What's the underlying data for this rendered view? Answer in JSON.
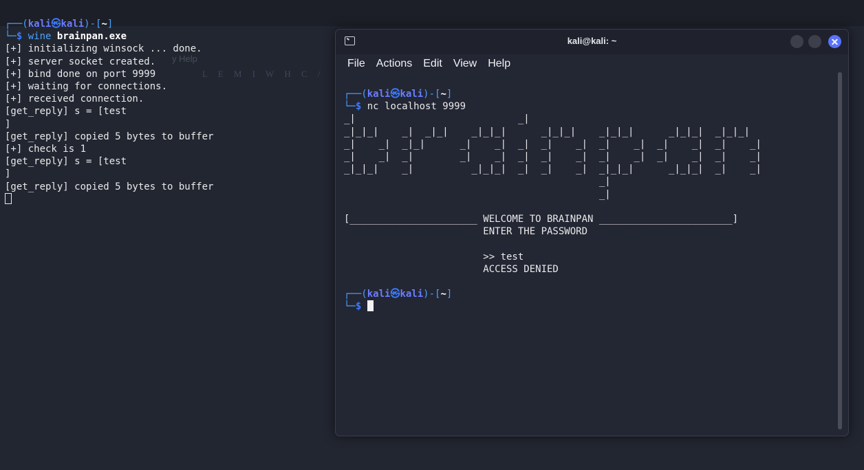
{
  "background": {
    "ghost_menu": "y  Help",
    "ghost_tools": "L E M I W H C /"
  },
  "left_terminal": {
    "prompt_open": "┌──(",
    "user": "kali",
    "at": "㉿",
    "host": "kali",
    "prompt_mid": ")-[",
    "dir": "~",
    "prompt_close": "]",
    "prompt_start": "└─",
    "dollar": "$",
    "cmd": "wine",
    "cmd_arg": "brainpan.exe",
    "lines": [
      "[+] initializing winsock ... done.",
      "[+] server socket created.",
      "[+] bind done on port 9999",
      "[+] waiting for connections.",
      "[+] received connection.",
      "[get_reply] s = [test",
      "]",
      "[get_reply] copied 5 bytes to buffer",
      "[+] check is 1",
      "[get_reply] s = [test",
      "]",
      "[get_reply] copied 5 bytes to buffer"
    ]
  },
  "window": {
    "title": "kali@kali: ~",
    "menu": [
      "File",
      "Actions",
      "Edit",
      "View",
      "Help"
    ]
  },
  "right_terminal": {
    "prompt_open": "┌──(",
    "user": "kali",
    "at": "㉿",
    "host": "kali",
    "prompt_mid": ")-[",
    "dir": "~",
    "prompt_close": "]",
    "prompt_start": "└─",
    "dollar": "$",
    "command": "nc localhost 9999",
    "banner": [
      "_|                            _|",
      "_|_|_|    _|  _|_|    _|_|_|      _|_|_|    _|_|_|      _|_|_|  _|_|_|",
      "_|    _|  _|_|      _|    _|  _|  _|    _|  _|    _|  _|    _|  _|    _|",
      "_|    _|  _|        _|    _|  _|  _|    _|  _|    _|  _|    _|  _|    _|",
      "_|_|_|    _|          _|_|_|  _|  _|    _|  _|_|_|      _|_|_|  _|    _|",
      "                                            _|",
      "                                            _|"
    ],
    "welcome_line": "[______________________ WELCOME TO BRAINPAN _______________________]",
    "enter_line": "                        ENTER THE PASSWORD",
    "input_line": "                        >> test",
    "denied_line": "                        ACCESS DENIED"
  }
}
